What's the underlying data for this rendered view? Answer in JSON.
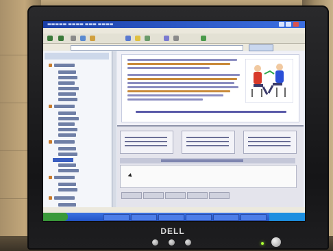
{
  "photo": {
    "subject": "computer monitor displaying a web browser",
    "monitor_brand": "DELL"
  },
  "colors": {
    "bezel": "#1a1a1c",
    "screen_bg": "#e8edf5",
    "title_bar": "#1a3fa8",
    "taskbar": "#2355c8",
    "power_led": "#aaff33"
  },
  "icons": [
    "power-button-icon",
    "cursor-icon",
    "people-illustration-icon"
  ]
}
